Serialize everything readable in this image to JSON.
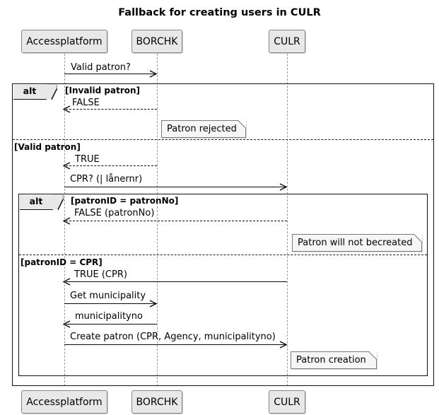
{
  "diagram": {
    "type": "uml-sequence-diagram",
    "title": "Fallback for creating users in CULR",
    "participants": [
      {
        "name": "Accessplatform"
      },
      {
        "name": "BORCHK"
      },
      {
        "name": "CULR"
      }
    ],
    "fragments": [
      {
        "operator": "alt",
        "guards": [
          "[Invalid patron]",
          "[Valid patron]"
        ]
      },
      {
        "operator": "alt",
        "guards": [
          "[patronID = patronNo]",
          "[patronID = CPR]"
        ]
      }
    ],
    "messages": [
      {
        "label": "Valid patron?",
        "from": "Accessplatform",
        "to": "BORCHK",
        "style": "solid"
      },
      {
        "label": "FALSE",
        "from": "BORCHK",
        "to": "Accessplatform",
        "style": "dashed"
      },
      {
        "label": "TRUE",
        "from": "BORCHK",
        "to": "Accessplatform",
        "style": "dashed"
      },
      {
        "label": "CPR? (| lånernr)",
        "from": "Accessplatform",
        "to": "CULR",
        "style": "solid"
      },
      {
        "label": "FALSE (patronNo)",
        "from": "CULR",
        "to": "Accessplatform",
        "style": "dashed"
      },
      {
        "label": "TRUE (CPR)",
        "from": "CULR",
        "to": "Accessplatform",
        "style": "solid"
      },
      {
        "label": "Get municipality",
        "from": "Accessplatform",
        "to": "BORCHK",
        "style": "solid"
      },
      {
        "label": "municipalityno",
        "from": "BORCHK",
        "to": "Accessplatform",
        "style": "solid"
      },
      {
        "label": "Create patron (CPR, Agency, municipalityno)",
        "from": "Accessplatform",
        "to": "CULR",
        "style": "solid"
      }
    ],
    "notes": [
      {
        "text": "Patron rejected"
      },
      {
        "text": "Patron will not becreated"
      },
      {
        "text": "Patron creation"
      }
    ],
    "colors": {
      "participant_fill": "#e8e8e8",
      "note_fill": "#f6f6f6",
      "line": "#0b0b0b",
      "lifeline": "#9a9a9a"
    }
  }
}
